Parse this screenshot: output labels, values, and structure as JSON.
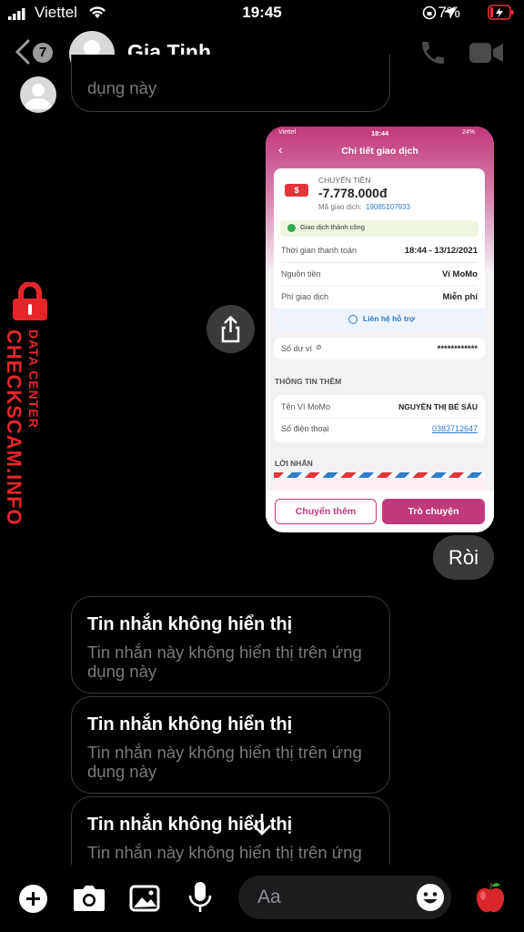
{
  "status_bar": {
    "carrier": "Viettel",
    "time": "19:45",
    "battery": "7%"
  },
  "header": {
    "back_count": "7",
    "contact_name": "Gia Tịnh"
  },
  "top_partial_message": "dụng này",
  "screenshot": {
    "status_carrier": "Viettel",
    "status_time": "18:44",
    "status_battery": "24%",
    "title": "Chi tiết giao dịch",
    "type_label": "CHUYỂN TIỀN",
    "amount": "-7.778.000đ",
    "txn_label": "Mã giao dịch:",
    "txn_id": "19085107933",
    "success_text": "Giao dịch thành công",
    "rows": [
      {
        "label": "Thời gian thanh toán",
        "value": "18:44 - 13/12/2021"
      },
      {
        "label": "Nguồn tiền",
        "value": "Ví MoMo"
      },
      {
        "label": "Phí giao dịch",
        "value": "Miễn phí"
      }
    ],
    "support_text": "Liên hệ hỗ trợ",
    "balance_label": "Số dư ví",
    "balance_value": "************",
    "extra_section": "THÔNG TIN THÊM",
    "extra_rows": [
      {
        "label": "Tên Ví MoMo",
        "value": "NGUYỄN THỊ BÉ SÁU"
      },
      {
        "label": "Số điện thoại",
        "value": "0383712647"
      }
    ],
    "message_section": "LỜI NHẮN",
    "btn_transfer_more": "Chuyển thêm",
    "btn_chat": "Trò chuyện"
  },
  "reply": "Ròi",
  "messages": [
    {
      "title": "Tin nhắn không hiển thị",
      "body": "Tin nhắn này không hiển thị trên ứng dụng này"
    },
    {
      "title": "Tin nhắn không hiển thị",
      "body": "Tin nhắn này không hiển thị trên ứng dụng này"
    },
    {
      "title": "Tin nhắn không hiển thị",
      "body": "Tin nhắn này không hiển thị trên ứng"
    }
  ],
  "composer": {
    "placeholder": "Aa"
  },
  "watermark": {
    "line1": "DATA CENTER",
    "line2": "CHECKSCAM.INFO"
  },
  "colors": {
    "momo": "#c2397a",
    "watermark": "#e4262b",
    "link": "#2f7cc9"
  }
}
